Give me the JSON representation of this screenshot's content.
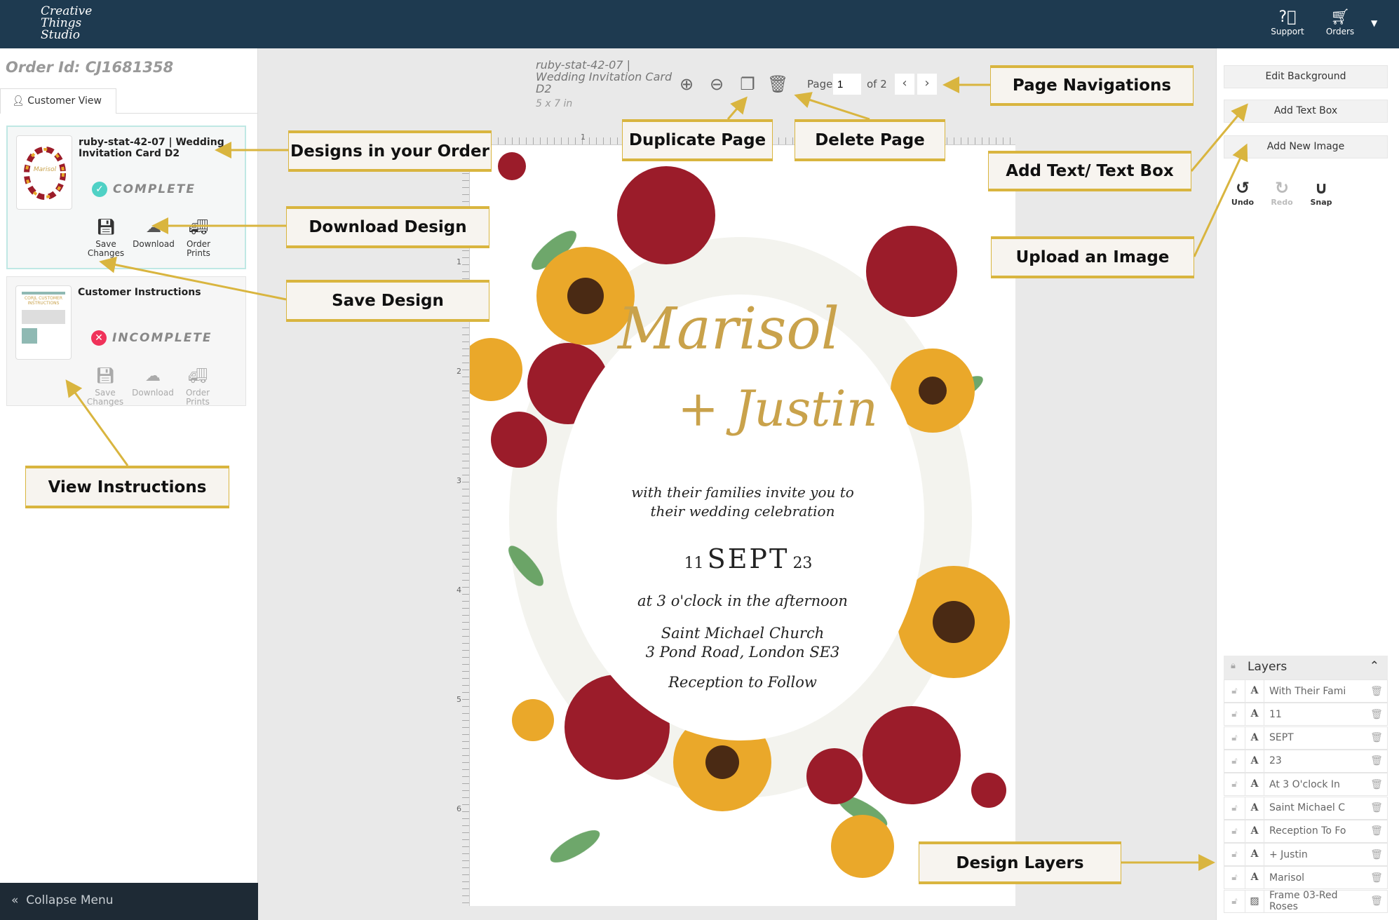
{
  "header": {
    "logo_text": "Creative Things Studio",
    "support_label": "Support",
    "orders_label": "Orders"
  },
  "left": {
    "order_id": "Order Id: CJ1681358",
    "tab_label": "Customer View",
    "designs": [
      {
        "title": "ruby-stat-42-07 | Wedding Invitation Card D2",
        "status": "COMPLETE",
        "status_color": "#4fd1c5",
        "actions": [
          "Save Changes",
          "Download",
          "Order Prints"
        ]
      },
      {
        "title": "Customer Instructions",
        "status": "INCOMPLETE",
        "status_color": "#f0325a",
        "actions": [
          "Save Changes",
          "Download",
          "Order Prints"
        ]
      }
    ],
    "collapse_label": "Collapse Menu"
  },
  "toolbar": {
    "doc_title": "ruby-stat-42-07 | Wedding Invitation Card D2",
    "doc_size": "5 x 7 in",
    "page_label": "Page",
    "page_value": "1",
    "page_of": "of 2"
  },
  "ruler": {
    "top_ticks": [
      "1"
    ],
    "left_ticks": [
      "1",
      "2",
      "3",
      "4",
      "5",
      "6"
    ]
  },
  "invitation": {
    "name1": "Marisol",
    "name2": "+ Justin",
    "line1": "with their families invite you to",
    "line2": "their wedding celebration",
    "day": "11",
    "month": "SEPT",
    "year": "23",
    "time": "at 3 o'clock in the afternoon",
    "venue1": "Saint Michael Church",
    "venue2": "3 Pond Road, London SE3",
    "reception": "Reception to Follow"
  },
  "right": {
    "edit_background": "Edit Background",
    "add_text_box": "Add Text Box",
    "add_new_image": "Add New Image",
    "undo": "Undo",
    "redo": "Redo",
    "snap": "Snap",
    "layers_title": "Layers",
    "layers": [
      {
        "type": "text",
        "name": "With Their Fami"
      },
      {
        "type": "text",
        "name": "11"
      },
      {
        "type": "text",
        "name": "SEPT"
      },
      {
        "type": "text",
        "name": "23"
      },
      {
        "type": "text",
        "name": "At 3 O'clock In"
      },
      {
        "type": "text",
        "name": "Saint Michael C"
      },
      {
        "type": "text",
        "name": "Reception To Fo"
      },
      {
        "type": "text",
        "name": "+ Justin"
      },
      {
        "type": "text",
        "name": "Marisol"
      },
      {
        "type": "image",
        "name": "Frame 03-Red Roses"
      }
    ]
  },
  "callouts": {
    "page_navigations": "Page Navigations",
    "designs_in_order": "Designs in your Order",
    "duplicate_page": "Duplicate Page",
    "delete_page": "Delete Page",
    "add_text": "Add Text/ Text Box",
    "download_design": "Download Design",
    "upload_image": "Upload an Image",
    "save_design": "Save Design",
    "view_instructions": "View Instructions",
    "design_layers": "Design Layers"
  },
  "colors": {
    "header": "#1e3a50",
    "callout_gold": "#d9b53f",
    "script_gold": "#c9a24b"
  }
}
